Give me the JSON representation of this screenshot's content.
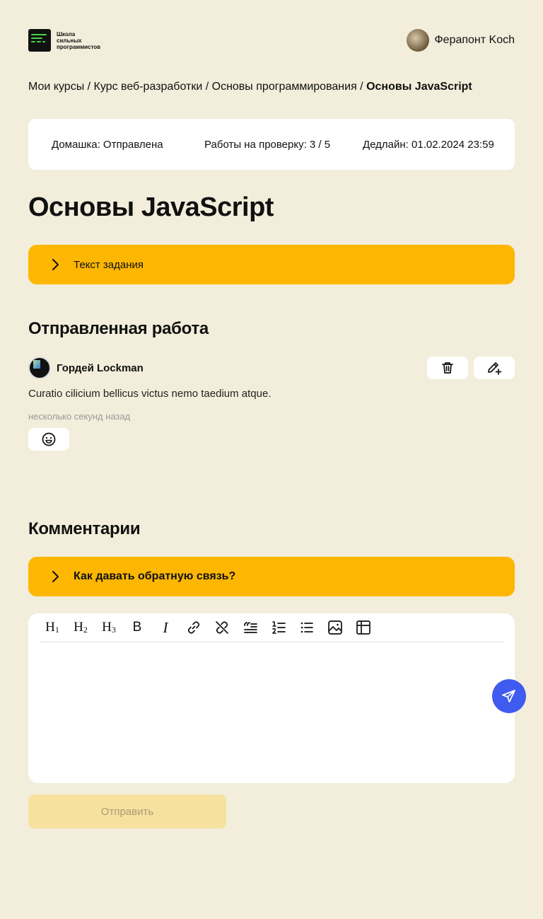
{
  "logo": {
    "lines": [
      "Школа",
      "сильных",
      "программистов"
    ]
  },
  "user": {
    "name": "Ферапонт Koch"
  },
  "breadcrumb": {
    "items": [
      "Мои курсы",
      "Курс веб-разработки",
      "Основы программирования"
    ],
    "separator": " / ",
    "current": "Основы JavaScript"
  },
  "status": {
    "homework": "Домашка: Отправлена",
    "reviews": "Работы на проверку: 3 / 5",
    "deadline": "Дедлайн: 01.02.2024 23:59"
  },
  "page_title": "Основы JavaScript",
  "task_accordion": {
    "label": "Текст задания"
  },
  "submitted": {
    "section_title": "Отправленная работа",
    "author": "Гордей Lockman",
    "text": "Curatio cilicium bellicus victus nemo taedium atque.",
    "time": "несколько секунд назад",
    "icons": {
      "delete": "trash-icon",
      "edit": "pencil-plus-icon",
      "reaction": "smile-icon"
    }
  },
  "comments": {
    "section_title": "Комментарии",
    "feedback_accordion": {
      "label": "Как давать обратную связь?"
    }
  },
  "editor": {
    "toolbar": {
      "h1": "H",
      "h1_sub": "1",
      "h2": "H",
      "h2_sub": "2",
      "h3": "H",
      "h3_sub": "3",
      "bold": "B",
      "italic": "I"
    },
    "icons": [
      "link-icon",
      "unlink-icon",
      "quote-icon",
      "ordered-list-icon",
      "bullet-list-icon",
      "image-icon",
      "table-icon",
      "send-icon"
    ]
  },
  "submit_button": {
    "label": "Отправить"
  },
  "colors": {
    "background": "#f2eedb",
    "accent": "#fdb703",
    "send": "#3f5bf0",
    "card": "#ffffff"
  }
}
